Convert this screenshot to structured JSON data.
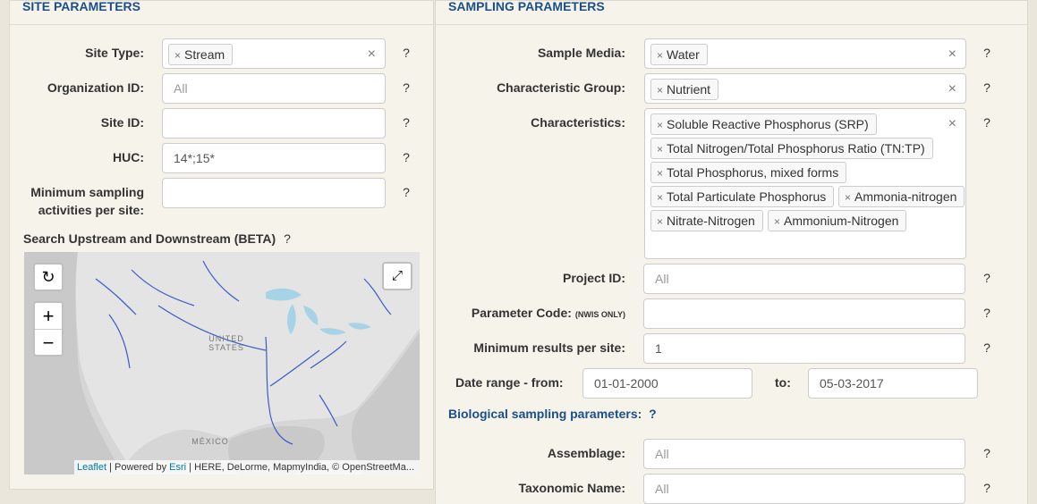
{
  "site_parameters": {
    "title": "SITE PARAMETERS",
    "site_type": {
      "label": "Site Type:",
      "tags": [
        "Stream"
      ],
      "help": "?"
    },
    "organization_id": {
      "label": "Organization ID:",
      "placeholder": "All",
      "help": "?"
    },
    "site_id": {
      "label": "Site ID:",
      "value": "",
      "help": "?"
    },
    "huc": {
      "label": "HUC:",
      "value": "14*;15*",
      "help": "?"
    },
    "min_activities": {
      "label_line1": "Minimum sampling",
      "label_line2": "activities per site:",
      "value": "",
      "help": "?"
    },
    "search_map": {
      "label": "Search Upstream and Downstream (BETA)",
      "help": "?",
      "zoom_in": "+",
      "zoom_out": "−",
      "reset_icon": "refresh-icon",
      "fullscreen_icon": "expand-icon",
      "place_labels": {
        "us_line1": "UNITED",
        "us_line2": "STATES",
        "mexico": "MÉXICO"
      },
      "attribution": {
        "leaflet": "Leaflet",
        "sep1": " | Powered by ",
        "esri": "Esri",
        "rest": " | HERE, DeLorme, MapmyIndia, © OpenStreetMa..."
      }
    }
  },
  "sampling_parameters": {
    "title": "SAMPLING PARAMETERS",
    "sample_media": {
      "label": "Sample Media:",
      "tags": [
        "Water"
      ],
      "help": "?"
    },
    "characteristic_group": {
      "label": "Characteristic Group:",
      "tags": [
        "Nutrient"
      ],
      "help": "?"
    },
    "characteristics": {
      "label": "Characteristics:",
      "tags": [
        "Soluble Reactive Phosphorus (SRP)",
        "Total Nitrogen/Total Phosphorus Ratio (TN:TP)",
        "Total Phosphorus, mixed forms",
        "Total Particulate Phosphorus",
        "Ammonia-nitrogen",
        "Nitrate-Nitrogen",
        "Ammonium-Nitrogen"
      ],
      "help": "?"
    },
    "project_id": {
      "label": "Project ID:",
      "placeholder": "All",
      "help": "?"
    },
    "parameter_code": {
      "label": "Parameter Code:",
      "label_note": "(NWIS ONLY)",
      "value": "",
      "help": "?"
    },
    "min_results": {
      "label": "Minimum results per site:",
      "value": "1",
      "help": "?"
    },
    "date_range": {
      "from_label": "Date range - from:",
      "from_value": "01-01-2000",
      "to_label": "to:",
      "to_value": "05-03-2017"
    },
    "biological": {
      "label": "Biological sampling parameters:",
      "help": "?"
    },
    "assemblage": {
      "label": "Assemblage:",
      "placeholder": "All",
      "help": "?"
    },
    "taxonomic_name": {
      "label": "Taxonomic Name:",
      "placeholder": "All",
      "help": "?"
    }
  },
  "clear_symbol": "×",
  "tag_remove_symbol": "×"
}
